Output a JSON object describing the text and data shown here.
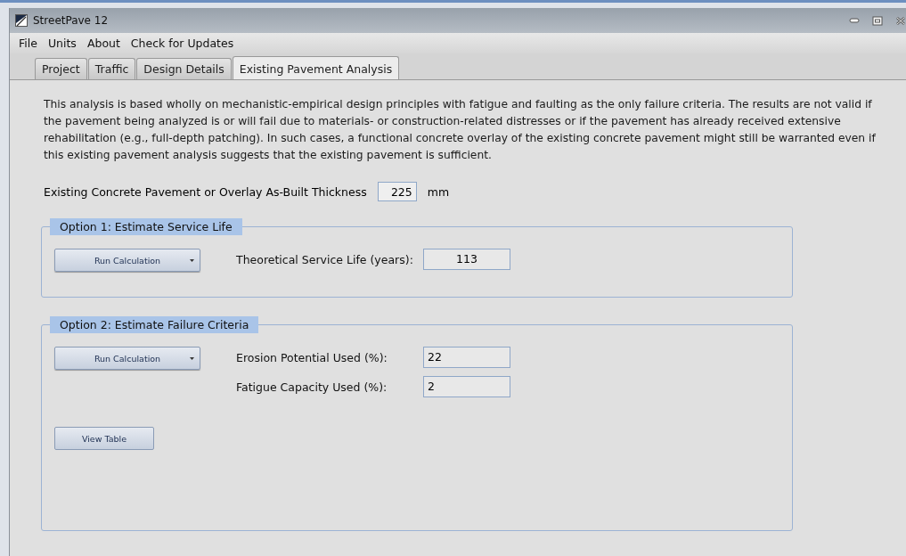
{
  "window": {
    "title": "StreetPave 12"
  },
  "menu": [
    "File",
    "Units",
    "About",
    "Check for Updates"
  ],
  "tabs": [
    {
      "label": "Project",
      "selected": false
    },
    {
      "label": "Traffic",
      "selected": false
    },
    {
      "label": "Design Details",
      "selected": false
    },
    {
      "label": "Existing Pavement Analysis",
      "selected": true
    }
  ],
  "notice": "This analysis is based wholly on mechanistic-empirical design principles with fatigue and faulting as the only failure criteria.  The results are not valid if the pavement being analyzed is or will fail due to materials- or construction-related distresses or if the pavement has already received extensive rehabilitation (e.g., full-depth patching).  In such cases, a functional concrete overlay of the existing concrete pavement might still be warranted even if this existing pavement analysis suggests that the existing pavement is sufficient.",
  "thickness": {
    "label": "Existing Concrete Pavement or Overlay As-Built Thickness",
    "value": "225",
    "unit": "mm"
  },
  "option_1": {
    "title": "Option 1: Estimate Service Life",
    "button": "Run Calculation",
    "results": [
      {
        "label": "Theoretical Service Life (years):",
        "value": "113"
      }
    ]
  },
  "option_2": {
    "title": "Option 2: Estimate Failure Criteria",
    "button": "Run Calculation",
    "results": [
      {
        "label": "Erosion Potential Used (%):",
        "value": "22"
      },
      {
        "label": "Fatigue Capacity Used (%):",
        "value": "2"
      }
    ],
    "table_button": "View Table"
  }
}
